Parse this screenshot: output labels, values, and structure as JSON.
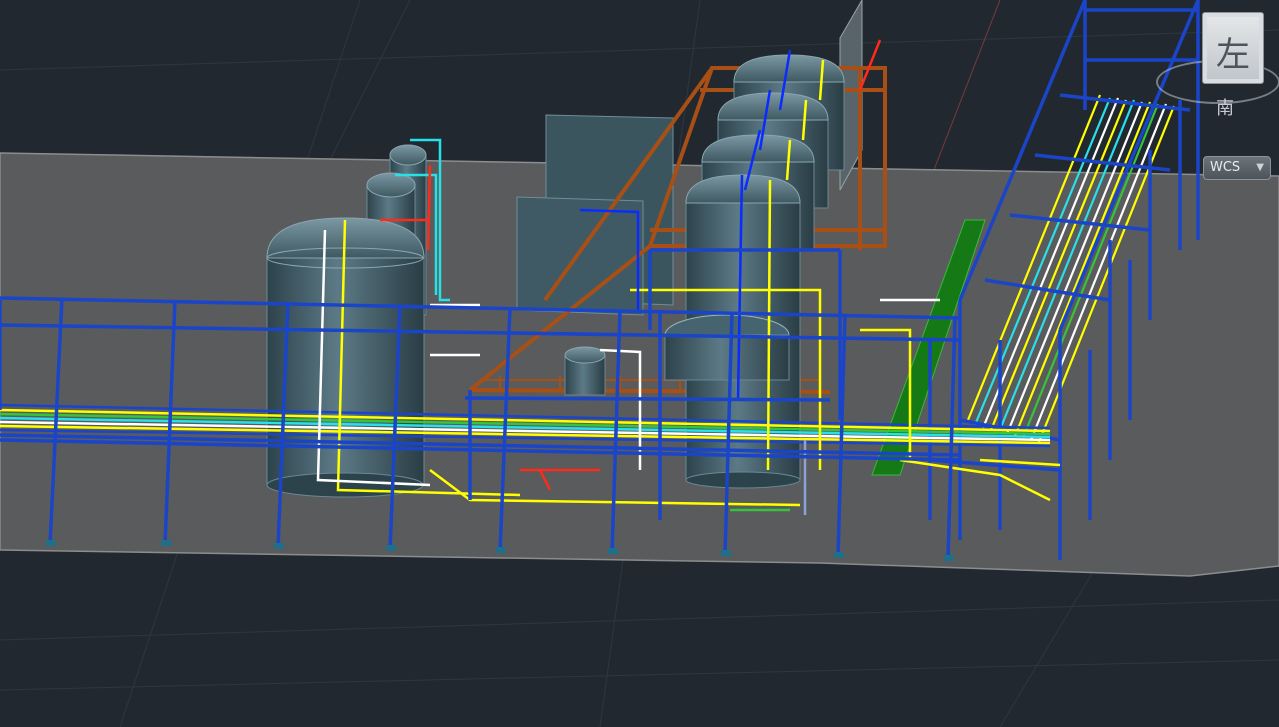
{
  "viewcube": {
    "face_label": "左",
    "compass_label": "南"
  },
  "ucs_menu": {
    "label": "WCS",
    "chevron": "chevron-down-icon"
  },
  "colors": {
    "background": "#212830",
    "ground": "#5a5b5c",
    "steel": "#1b45c8",
    "platform": "#a84f16",
    "tank": "#3e5863",
    "pipe_yellow": "#ffff00",
    "pipe_cyan": "#27e0e8",
    "pipe_white": "#ffffff",
    "pipe_red": "#ff2a1a",
    "pipe_green": "#37c33a"
  }
}
